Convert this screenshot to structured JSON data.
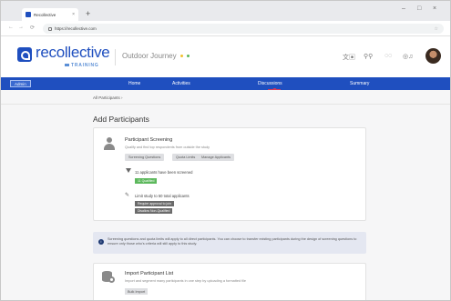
{
  "browser": {
    "tab_title": "Recollective",
    "tab_close": "×",
    "new_tab": "+",
    "url": "https://recollective.com",
    "window_controls": {
      "minimize": "–",
      "maximize": "□",
      "close": "×"
    }
  },
  "header": {
    "logo_text": "recollective",
    "logo_sub": "TRAINING",
    "project_name": "Outdoor Journey",
    "project_dot_colors": [
      "#f2c12e",
      "#5cb85c"
    ],
    "avatar_alt": "user avatar"
  },
  "nav": {
    "admin_label": "Admin",
    "items": [
      "Home",
      "Activities",
      "Discussions",
      "Summary"
    ],
    "active_index": 2,
    "accent": "#d63a5a",
    "brand": "#1f4fbf"
  },
  "breadcrumb": {
    "text": "All Participants  ›"
  },
  "page": {
    "title": "Add Participants",
    "screening": {
      "title": "Participant Screening",
      "desc": "Qualify and find top respondents from outside the study",
      "chips": [
        "Screening Questions",
        "Quota Limits",
        "Manage Applicants"
      ],
      "applicants_text": "11 applicants have been screened",
      "qualified_badge": "11 Qualified",
      "limit_text": "Limit study to 50 total applicants",
      "limit_badges": [
        "Require approval to join",
        "Disallow Non-Qualified"
      ]
    },
    "notice": "Screening questions and quota limits will apply to all direct participants. You can choose to transfer existing participants during the design of screening questions to ensure only those who's criteria will still apply to this study.",
    "import": {
      "title": "Import Participant List",
      "desc": "Import and segment many participants in one step by uploading a formatted file",
      "button": "Bulk Import"
    }
  }
}
